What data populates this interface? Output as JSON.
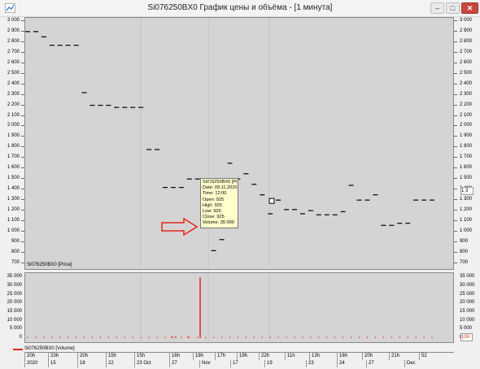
{
  "window": {
    "title": "Si076250BX0 График цены и объёма - [1 минута]",
    "buttons": [
      "–",
      "□",
      "✕"
    ]
  },
  "colors": {
    "chart_bg": "#d4d4d4",
    "price_bar": "#111111",
    "volume": "#e8251c",
    "arrow": "#e8251c",
    "tooltip_bg": "#ffffcc"
  },
  "price_pane": {
    "legend": "Si076250BX0 [Price]",
    "ticks": [
      "3 000",
      "2 900",
      "2 800",
      "2 700",
      "2 600",
      "2 500",
      "2 400",
      "2 300",
      "2 200",
      "2 100",
      "2 000",
      "1 900",
      "1 800",
      "1 700",
      "1 600",
      "1 500",
      "1 400",
      "1 300",
      "1 200",
      "1 100",
      "1 000",
      "900",
      "800",
      "700"
    ],
    "last_price_label": "1 3",
    "tooltip": {
      "title": "Si076250BX0 [Price]",
      "lines": [
        "Date: 09.11.2020",
        "Time: 12:00",
        "Open:  925",
        "High:   925",
        "Low:    925",
        "Close: 925",
        "Volume: 35 000"
      ]
    }
  },
  "volume_pane": {
    "legend": "Si076250BX0 [Volume]",
    "ticks": [
      "35 000",
      "30 000",
      "25 000",
      "20 000",
      "15 000",
      "10 000",
      "5 000",
      "0"
    ],
    "last_volume_label": "100"
  },
  "time_axis": {
    "top": [
      "20h",
      "23h",
      "20h",
      "15h",
      "15h",
      "16h",
      "18h",
      "17h",
      "19h",
      "22h",
      "11h",
      "13h",
      "16h",
      "20h",
      "21h",
      "52"
    ],
    "bottom": [
      "2020",
      "15",
      "18",
      "22",
      "23 Oct",
      "27",
      "Nov",
      "17",
      "19",
      "23",
      "24",
      "27",
      "Dec"
    ]
  },
  "chart_data": {
    "type": "line",
    "price_bars": [
      2900,
      2900,
      2850,
      2770,
      2770,
      2770,
      2770,
      2320,
      2200,
      2200,
      2200,
      2180,
      2180,
      2180,
      2180,
      1780,
      1780,
      1420,
      1420,
      1420,
      1500,
      1500,
      1500,
      820,
      925,
      1650,
      1500,
      1550,
      1450,
      1350,
      1170,
      1300,
      1210,
      1210,
      1170,
      1200,
      1160,
      1160,
      1160,
      1190,
      1440,
      1300,
      1300,
      1350,
      1060,
      1060,
      1080,
      1080,
      1300,
      1300,
      1300
    ],
    "last_price_marker": 1300,
    "price_ylim": [
      630,
      3030
    ],
    "volume_spike": {
      "date": "09.11.2020",
      "value": 35000
    },
    "volume_ylim": [
      0,
      37500
    ]
  }
}
